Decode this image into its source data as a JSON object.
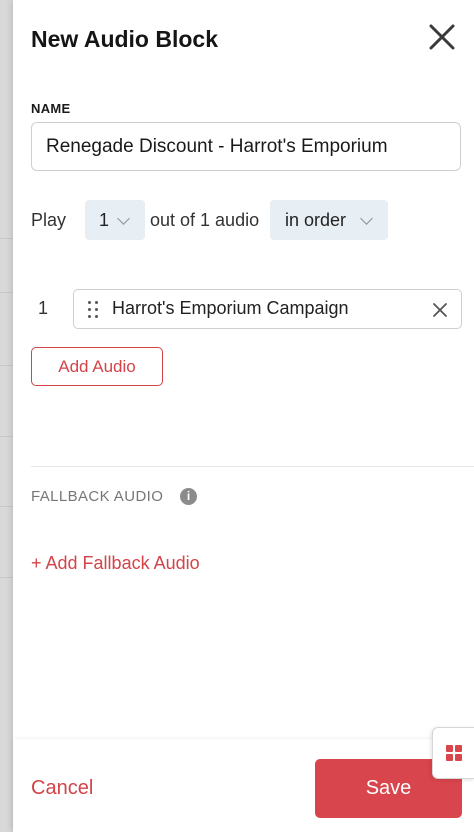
{
  "dialog": {
    "title": "New Audio Block",
    "close_icon": "close-icon"
  },
  "name_section": {
    "label": "NAME",
    "value": "Renegade Discount - Harrot's Emporium"
  },
  "play_row": {
    "play_label": "Play",
    "count_value": "1",
    "out_of_label": "out of 1 audio",
    "order_value": "in order"
  },
  "audio_list": [
    {
      "index": "1",
      "name": "Harrot's Emporium Campaign"
    }
  ],
  "add_audio_label": "Add Audio",
  "fallback": {
    "label": "FALLBACK AUDIO",
    "info_icon": "i",
    "add_label": "+ Add Fallback Audio"
  },
  "footer": {
    "cancel_label": "Cancel",
    "save_label": "Save"
  },
  "colors": {
    "accent": "#d9454c",
    "select_bg": "#e7eef4"
  }
}
